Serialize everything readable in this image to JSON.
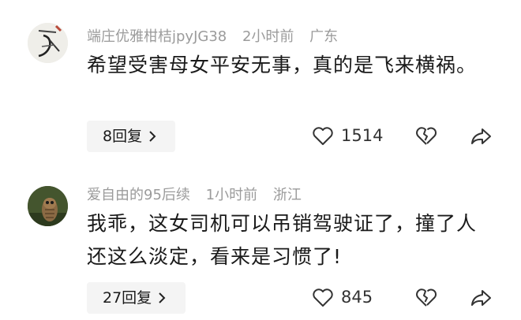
{
  "comments": [
    {
      "username": "端庄优雅柑桔jpyJG38",
      "time": "2小时前",
      "location": "广东",
      "text": "希望受害母女平安无事，真的是飞来横祸。",
      "reply_label": "8回复",
      "like_count": "1514",
      "avatar_icon": "calligraphy-avatar-icon"
    },
    {
      "username": "爱自由的95后续",
      "time": "1小时前",
      "location": "浙江",
      "text": "我乖，这女司机可以吊销驾驶证了，撞了人还这么淡定，看来是习惯了!",
      "reply_label": "27回复",
      "like_count": "845",
      "avatar_icon": "owl-avatar-icon"
    }
  ],
  "icons": [
    "heart-icon",
    "broken-heart-icon",
    "share-icon",
    "chevron-right-icon"
  ]
}
